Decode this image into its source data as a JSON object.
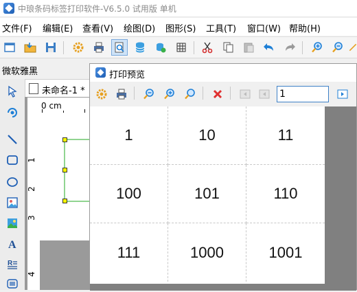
{
  "window": {
    "title": "中琅条码标签打印软件-V6.5.0 试用版 单机"
  },
  "menu": {
    "items": [
      {
        "label": "文件(F)"
      },
      {
        "label": "编辑(E)"
      },
      {
        "label": "查看(V)"
      },
      {
        "label": "绘图(D)"
      },
      {
        "label": "图形(S)"
      },
      {
        "label": "工具(T)"
      },
      {
        "label": "窗口(W)"
      },
      {
        "label": "帮助(H)"
      }
    ]
  },
  "toolbar": {
    "icons": [
      "new-document-icon",
      "open-folder-icon",
      "save-icon",
      "settings-gear-icon",
      "print-icon",
      "print-preview-icon",
      "database-icon",
      "database-link-icon",
      "grid-icon",
      "cut-icon",
      "copy-icon",
      "paste-icon",
      "undo-icon",
      "redo-icon",
      "zoom-in-icon",
      "zoom-out-icon",
      "ruler-icon"
    ]
  },
  "font": {
    "current": "微软雅黑"
  },
  "document": {
    "tab_label": "未命名-1 *",
    "ruler_unit": "0 cm",
    "vruler_marks": [
      "1",
      "2",
      "3",
      "4"
    ]
  },
  "preview": {
    "title": "打印预览",
    "page_number": "1",
    "labels": [
      [
        "1",
        "10",
        "11"
      ],
      [
        "100",
        "101",
        "110"
      ],
      [
        "111",
        "1000",
        "1001"
      ]
    ]
  },
  "colors": {
    "accent": "#3c7fc6",
    "handle": "#ffff00",
    "close": "#e03030"
  }
}
